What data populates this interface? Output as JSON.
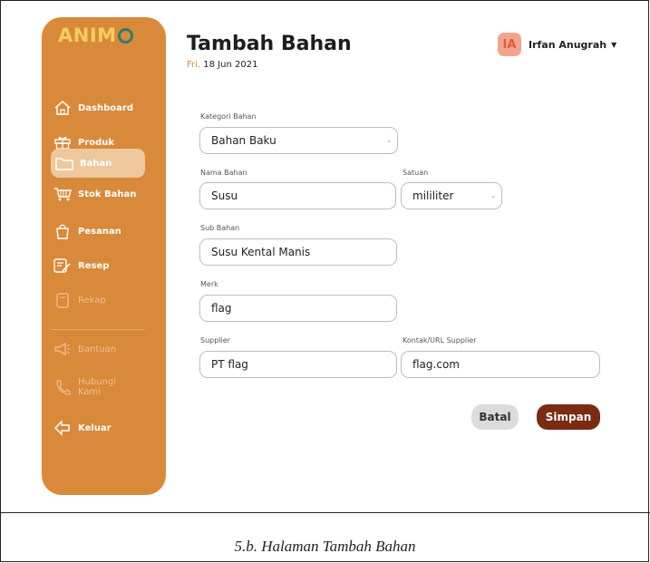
{
  "brand": {
    "logo_text": "ANIM",
    "logo_accent": "#f3cf59",
    "sidebar_color": "#d9893a"
  },
  "sidebar": {
    "items": [
      {
        "label": "Dashboard",
        "icon": "home-icon"
      },
      {
        "label": "Produk",
        "icon": "gift-icon"
      },
      {
        "label": "Bahan",
        "icon": "folder-icon",
        "active": true
      },
      {
        "label": "Stok Bahan",
        "icon": "cart-icon"
      },
      {
        "label": "Pesanan",
        "icon": "bag-icon"
      },
      {
        "label": "Resep",
        "icon": "recipe-icon"
      },
      {
        "label": "Rekap",
        "icon": "document-icon",
        "disabled": true
      },
      {
        "label": "Bantuan",
        "icon": "megaphone-icon",
        "disabled": true
      },
      {
        "label": "Hubungi Kami",
        "icon": "phone-icon",
        "disabled": true
      },
      {
        "label": "Keluar",
        "icon": "logout-icon"
      }
    ]
  },
  "header": {
    "title": "Tambah Bahan",
    "date_day": "Fri,",
    "date_rest": " 18 Jun 2021",
    "user_initials": "IA",
    "user_name": "Irfan Anugrah"
  },
  "form": {
    "kategori": {
      "label": "Kategori Bahan",
      "value": "Bahan Baku"
    },
    "nama": {
      "label": "Nama Bahan",
      "value": "Susu"
    },
    "satuan": {
      "label": "Satuan",
      "value": "mililiter"
    },
    "sub": {
      "label": "Sub Bahan",
      "value": "Susu Kental Manis"
    },
    "merk": {
      "label": "Merk",
      "value": "flag"
    },
    "supplier": {
      "label": "Supplier",
      "value": "PT flag"
    },
    "kontak": {
      "label": "Kontak/URL Supplier",
      "value": "flag.com"
    }
  },
  "actions": {
    "cancel": "Batal",
    "save": "Simpan"
  },
  "caption": "5.b.  Halaman Tambah Bahan"
}
